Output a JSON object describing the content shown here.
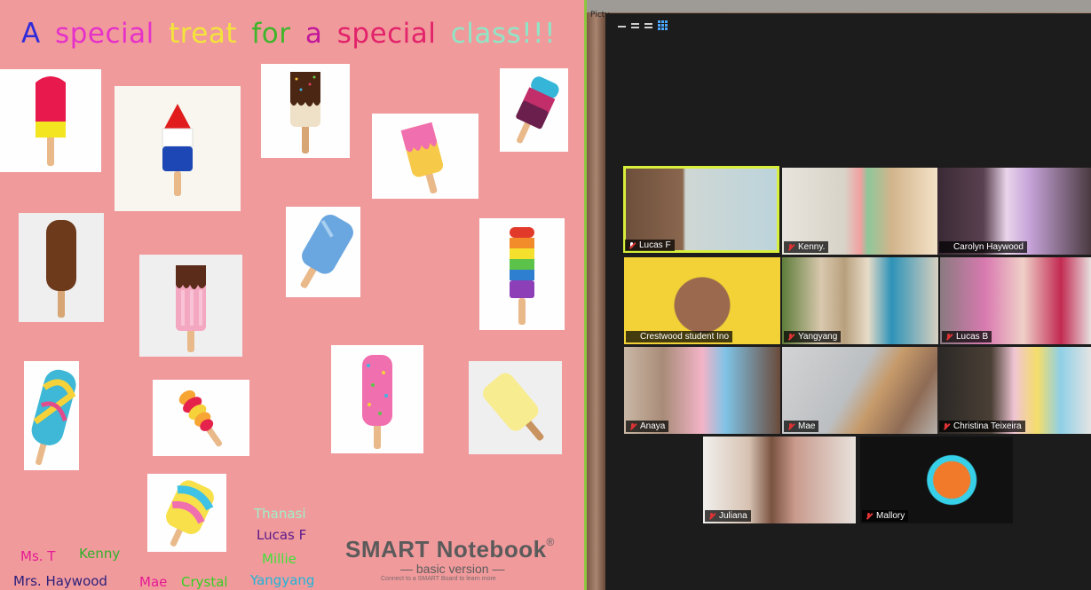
{
  "notebook": {
    "title_words": [
      {
        "text": "A",
        "color": "#2e2bd9"
      },
      {
        "text": "special",
        "color": "#e531c9"
      },
      {
        "text": "treat",
        "color": "#f3e43a"
      },
      {
        "text": "for",
        "color": "#3fb52b"
      },
      {
        "text": "a",
        "color": "#c2169a"
      },
      {
        "text": "special",
        "color": "#e2226a"
      },
      {
        "text": "class!!!",
        "color": "#8fe6c6"
      }
    ],
    "names": [
      {
        "text": "Thanasi",
        "color": "#9ff0c9"
      },
      {
        "text": "Lucas F",
        "color": "#5b1a8a"
      },
      {
        "text": "Millie",
        "color": "#3fe13a"
      },
      {
        "text": "Yangyang",
        "color": "#1fb4d7"
      },
      {
        "text": "Ms. T",
        "color": "#e51a95"
      },
      {
        "text": "Kenny",
        "color": "#2eb02a"
      },
      {
        "text": "Mrs. Haywood",
        "color": "#2a1f7a"
      },
      {
        "text": "Mae",
        "color": "#e51a95"
      },
      {
        "text": "Crystal",
        "color": "#35d020"
      }
    ],
    "logo": {
      "name": "SMART Notebook",
      "mark": "®",
      "edition": "— basic version —",
      "fine": "Connect to a SMART Board to learn more"
    }
  },
  "desktop": {
    "corner_label": "Pictu"
  },
  "zoom": {
    "participants": [
      {
        "name": "Lucas F",
        "muted": false,
        "active": true
      },
      {
        "name": "Kenny.",
        "muted": true,
        "active": false
      },
      {
        "name": "Carolyn Haywood",
        "muted": false,
        "active": false
      },
      {
        "name": "Crestwood student Ino",
        "muted": false,
        "active": false
      },
      {
        "name": "Yangyang",
        "muted": true,
        "active": false
      },
      {
        "name": "Lucas B",
        "muted": true,
        "active": false
      },
      {
        "name": "Anaya",
        "muted": true,
        "active": false
      },
      {
        "name": "Mae",
        "muted": true,
        "active": false
      },
      {
        "name": "Christina Teixeira",
        "muted": true,
        "active": false
      },
      {
        "name": "Juliana",
        "muted": true,
        "active": false
      },
      {
        "name": "Mallory",
        "muted": true,
        "active": false
      }
    ]
  }
}
